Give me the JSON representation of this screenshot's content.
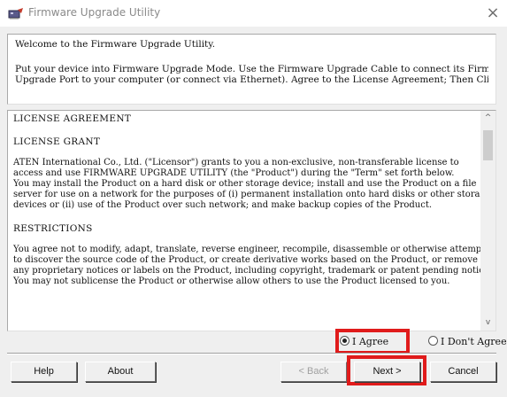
{
  "window": {
    "title": "Firmware Upgrade Utility",
    "close_glyph": "×"
  },
  "welcome": {
    "line1": "Welcome to the Firmware Upgrade Utility.",
    "line2": "Put your device into Firmware Upgrade Mode. Use the Firmware Upgrade Cable to connect its Firmware",
    "line3": "Upgrade Port to your computer (or connect via Ethernet). Agree to the License Agreement; Then Click Next."
  },
  "license": {
    "heading": "LICENSE AGREEMENT",
    "grant_heading": "LICENSE GRANT",
    "grant_lines": [
      "ATEN International Co., Ltd. (\"Licensor\") grants to you a non-exclusive, non-transferable license to",
      "access and use FIRMWARE UPGRADE UTILITY (the \"Product\") during the \"Term\" set forth below.",
      "You may install the Product on a hard disk or other storage device; install and use the Product on a file",
      "server for use on a network for the purposes of (i) permanent installation onto hard disks or other storage",
      "devices or (ii) use of the Product over such network; and make backup copies of the Product."
    ],
    "restrictions_heading": "RESTRICTIONS",
    "restrictions_lines": [
      "You agree not to modify, adapt, translate, reverse engineer, recompile, disassemble or otherwise attempt",
      "to discover the source code of the Product, or create derivative works based on the Product, or remove",
      "any proprietary notices or labels on the Product, including copyright, trademark or patent pending notices.",
      "You may not sublicense the Product or otherwise allow others to use the Product licensed to you."
    ]
  },
  "scrollbar": {
    "up_glyph": "^",
    "down_glyph": "v"
  },
  "agreement": {
    "agree_label": "I Agree",
    "disagree_label": "I Don't Agree",
    "selected": "agree"
  },
  "buttons": {
    "help": "Help",
    "about": "About",
    "back": "< Back",
    "next": "Next >",
    "cancel": "Cancel"
  },
  "colors": {
    "highlight": "#e01b1b",
    "disabled_text": "#a0a0a0"
  }
}
